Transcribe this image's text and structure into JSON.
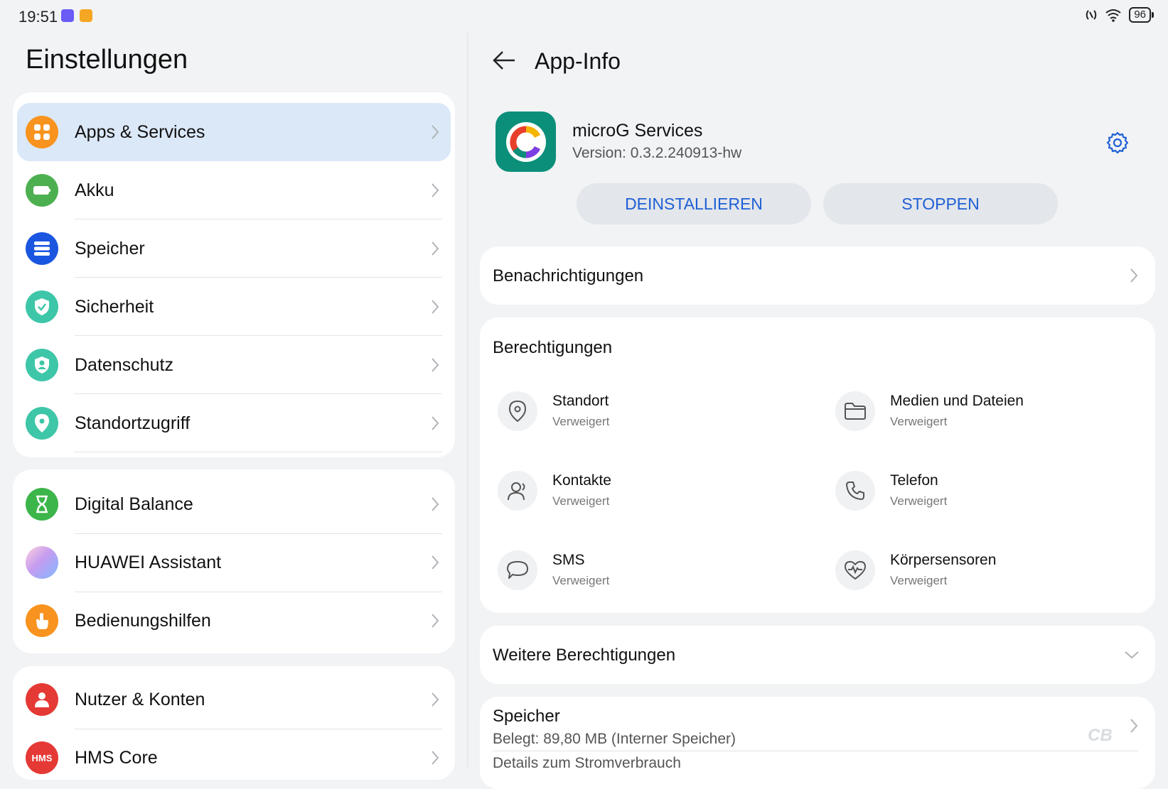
{
  "status_bar": {
    "time": "19:51",
    "battery": "96"
  },
  "left": {
    "title": "Einstellungen",
    "groups": [
      [
        {
          "label": "Apps & Services",
          "icon": "apps-icon",
          "color": "#f7931e",
          "selected": true
        },
        {
          "label": "Akku",
          "icon": "battery-icon",
          "color": "#4cb050"
        },
        {
          "label": "Speicher",
          "icon": "storage-icon",
          "color": "#1a56e0"
        },
        {
          "label": "Sicherheit",
          "icon": "shield-icon",
          "color": "#3ec6a8"
        },
        {
          "label": "Datenschutz",
          "icon": "privacy-icon",
          "color": "#3ec6a8"
        },
        {
          "label": "Standortzugriff",
          "icon": "location-icon",
          "color": "#3ec6a8"
        }
      ],
      [
        {
          "label": "Digital Balance",
          "icon": "hourglass-icon",
          "color": "#3cb54a"
        },
        {
          "label": "HUAWEI Assistant",
          "icon": "assistant-icon",
          "color": "#c59cf0"
        },
        {
          "label": "Bedienungshilfen",
          "icon": "hand-icon",
          "color": "#f7931e"
        }
      ],
      [
        {
          "label": "Nutzer & Konten",
          "icon": "user-icon",
          "color": "#e53935"
        },
        {
          "label": "HMS Core",
          "icon": "hms-icon",
          "color": "#e53935",
          "badge": "HMS"
        }
      ]
    ]
  },
  "right": {
    "title": "App-Info",
    "app": {
      "name": "microG Services",
      "version": "Version: 0.3.2.240913-hw"
    },
    "buttons": {
      "uninstall": "DEINSTALLIEREN",
      "stop": "STOPPEN"
    },
    "notifications": "Benachrichtigungen",
    "permissions": {
      "title": "Berechtigungen",
      "items": [
        {
          "name": "Standort",
          "status": "Verweigert",
          "icon": "location-pin-icon"
        },
        {
          "name": "Medien und Dateien",
          "status": "Verweigert",
          "icon": "folder-icon"
        },
        {
          "name": "Kontakte",
          "status": "Verweigert",
          "icon": "contacts-icon"
        },
        {
          "name": "Telefon",
          "status": "Verweigert",
          "icon": "phone-icon"
        },
        {
          "name": "SMS",
          "status": "Verweigert",
          "icon": "sms-icon"
        },
        {
          "name": "Körpersensoren",
          "status": "Verweigert",
          "icon": "heart-icon"
        }
      ]
    },
    "more_permissions": "Weitere Berechtigungen",
    "storage": {
      "title": "Speicher",
      "used": "Belegt: 89,80 MB (Interner Speicher)"
    },
    "power_details": "Details zum Stromverbrauch"
  },
  "colors": {
    "accent": "#1e5fd6",
    "selected_bg": "#dbe8f8"
  }
}
